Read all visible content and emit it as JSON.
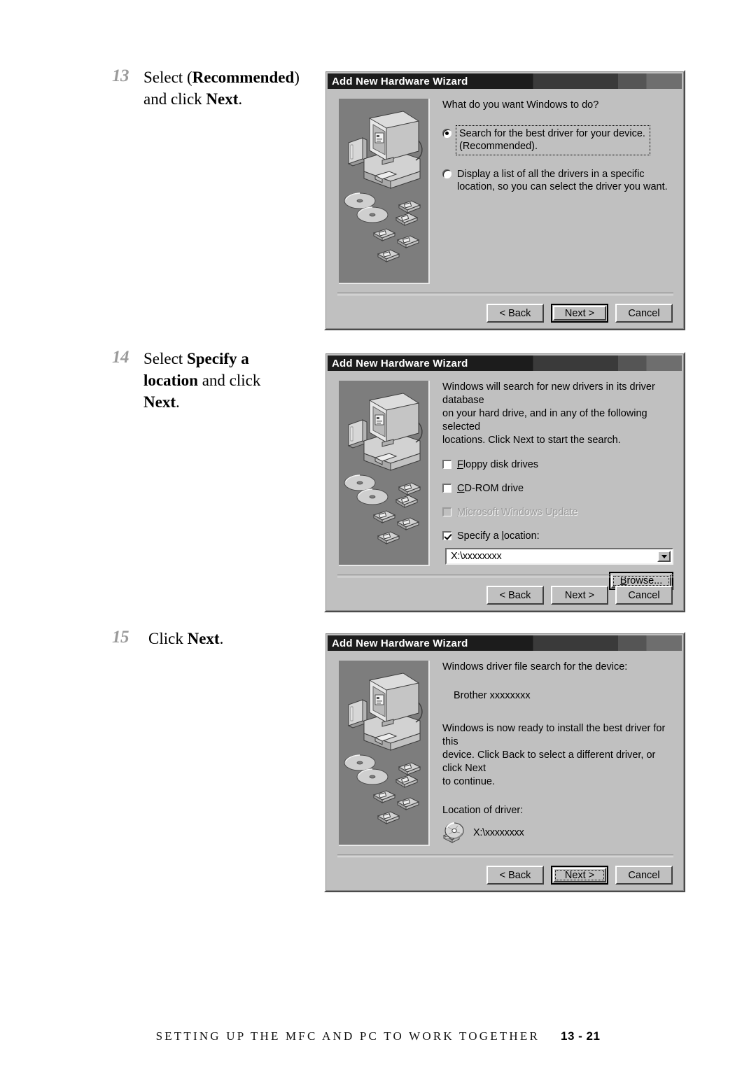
{
  "page": {
    "footer_title": "SETTING UP THE MFC AND PC TO WORK TOGETHER",
    "footer_page": "13 - 21"
  },
  "steps": [
    {
      "number": "13",
      "parts": [
        {
          "t": "Select ",
          "b": false
        },
        {
          "t": "(",
          "b": false
        },
        {
          "t": "Recommended",
          "b": true
        },
        {
          "t": ")",
          "b": false
        },
        {
          "t": " and click ",
          "b": false
        },
        {
          "t": "Next",
          "b": true
        },
        {
          "t": ".",
          "b": false
        }
      ]
    },
    {
      "number": "14",
      "parts": [
        {
          "t": "Select ",
          "b": false
        },
        {
          "t": "Specify a location",
          "b": true
        },
        {
          "t": " and click ",
          "b": false
        },
        {
          "t": "Next",
          "b": true
        },
        {
          "t": ".",
          "b": false
        }
      ]
    },
    {
      "number": "15",
      "parts": [
        {
          "t": "Click ",
          "b": false
        },
        {
          "t": "Next",
          "b": true
        },
        {
          "t": ".",
          "b": false
        }
      ]
    }
  ],
  "dialog1": {
    "title": "Add New Hardware Wizard",
    "prompt": "What do you want Windows to do?",
    "option1_line1": "Search for the best driver for your device.",
    "option1_line2": "(Recommended).",
    "option1_selected": true,
    "option2_line1": "Display a list of all the drivers in a specific",
    "option2_line2": "location, so you can select the driver you want.",
    "option2_selected": false,
    "buttons": {
      "back": "< Back",
      "back_accel": "B",
      "next": "Next >",
      "cancel": "Cancel",
      "default_button": "next"
    }
  },
  "dialog2": {
    "title": "Add New Hardware Wizard",
    "prompt_line1": "Windows will search for new drivers in its driver database",
    "prompt_line2": "on your hard drive, and in any of the following selected",
    "prompt_line3": "locations. Click Next to start the search.",
    "checkboxes": [
      {
        "label_pre": "",
        "label_accel": "F",
        "label_post": "loppy disk drives",
        "checked": false,
        "disabled": false
      },
      {
        "label_pre": "",
        "label_accel": "C",
        "label_post": "D-ROM drive",
        "checked": false,
        "disabled": false
      },
      {
        "label_pre": "",
        "label_accel": "M",
        "label_post": "icrosoft Windows Update",
        "checked": false,
        "disabled": true
      },
      {
        "label_pre": "Specify a ",
        "label_accel": "l",
        "label_post": "ocation:",
        "checked": true,
        "disabled": false
      }
    ],
    "location_value": "X:\\xxxxxxxx",
    "browse_label_pre": "",
    "browse_accel": "B",
    "browse_label_post": "rowse...",
    "buttons": {
      "back": "< Back",
      "back_accel": "B",
      "next": "Next >",
      "cancel": "Cancel",
      "default_button": "none"
    }
  },
  "dialog3": {
    "title": "Add New Hardware Wizard",
    "prompt": "Windows driver file search for the device:",
    "device_name": "Brother  xxxxxxxx",
    "body_line1": "Windows is now ready to install the best driver for this",
    "body_line2": "device. Click Back to select a different driver, or click Next",
    "body_line3": "to continue.",
    "location_label": "Location of driver:",
    "location_value": "X:\\xxxxxxxx",
    "buttons": {
      "back": "< Back",
      "back_accel": "B",
      "next": "Next >",
      "cancel": "Cancel",
      "default_button": "next",
      "focused_button": "next"
    }
  },
  "colors": {
    "dialog_face": "#c0c0c0",
    "titlebar_dark": "#1c1c1c",
    "illustration_bg": "#7d7d7d",
    "step_number": "#9a9a9a"
  },
  "icons": {
    "illustration": "computer-drivers-illustration",
    "cd_drive": "cd-drive-icon",
    "dropdown": "chevron-down-icon"
  }
}
